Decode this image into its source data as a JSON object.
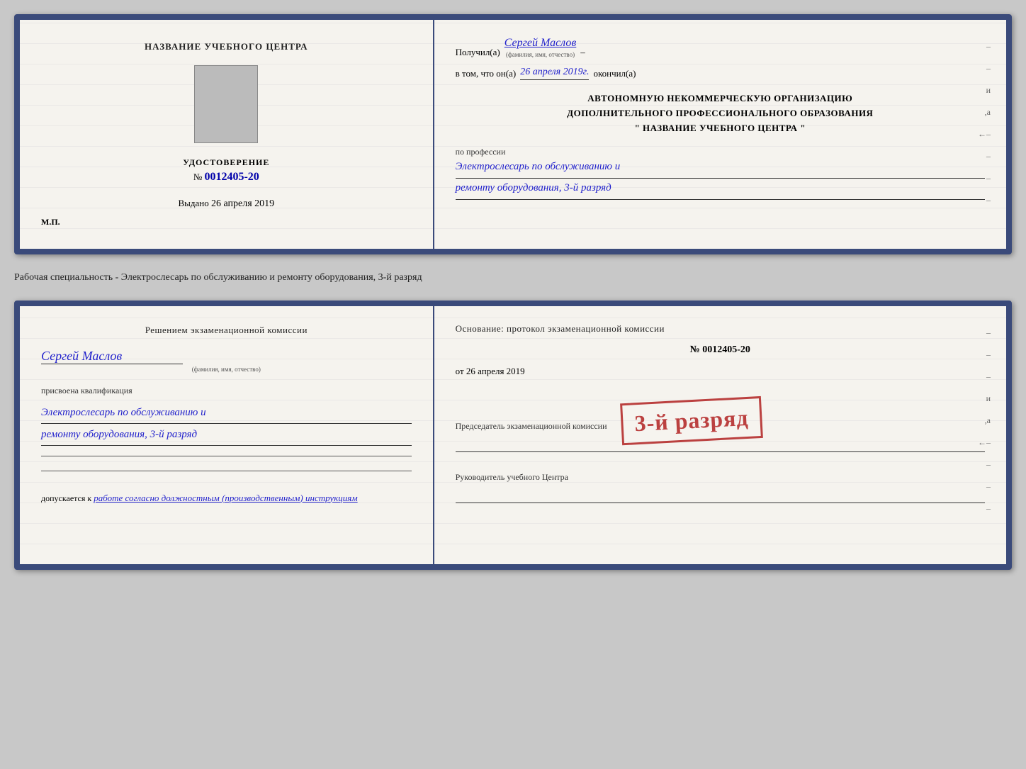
{
  "page": {
    "background": "#c8c8c8"
  },
  "card1": {
    "left": {
      "title": "НАЗВАНИЕ УЧЕБНОГО ЦЕНТРА",
      "document_type": "УДОСТОВЕРЕНИЕ",
      "number_prefix": "№",
      "number_value": "0012405-20",
      "issued_label": "Выдано",
      "issued_date": "26 апреля 2019",
      "mp_label": "М.П."
    },
    "right": {
      "received_label": "Получил(а)",
      "recipient_name": "Сергей Маслов",
      "recipient_sub": "(фамилия, имя, отчество)",
      "date_preamble": "в том, что он(а)",
      "date_value": "26 апреля 2019г.",
      "finished_label": "окончил(а)",
      "org_line1": "АВТОНОМНУЮ НЕКОММЕРЧЕСКУЮ ОРГАНИЗАЦИЮ",
      "org_line2": "ДОПОЛНИТЕЛЬНОГО ПРОФЕССИОНАЛЬНОГО ОБРАЗОВАНИЯ",
      "org_line3": "\"  НАЗВАНИЕ УЧЕБНОГО ЦЕНТРА  \"",
      "profession_label": "по профессии",
      "profession_line1": "Электрослесарь по обслуживанию и",
      "profession_line2": "ремонту оборудования, 3-й разряд"
    }
  },
  "between_text": "Рабочая специальность - Электрослесарь по обслуживанию и ремонту оборудования, 3-й разряд",
  "card2": {
    "left": {
      "commission_text": "Решением экзаменационной комиссии",
      "name": "Сергей Маслов",
      "name_sub": "(фамилия, имя, отчество)",
      "assigned_label": "присвоена квалификация",
      "qualification_line1": "Электрослесарь по обслуживанию и",
      "qualification_line2": "ремонту оборудования, 3-й разряд",
      "admitted_prefix": "допускается к",
      "admitted_text": "работе согласно должностным (производственным) инструкциям"
    },
    "right": {
      "basis_text": "Основание: протокол экзаменационной комиссии",
      "number_prefix": "№",
      "number_value": "0012405-20",
      "date_prefix": "от",
      "date_value": "26 апреля 2019",
      "chairman_label": "Председатель экзаменационной комиссии",
      "head_label": "Руководитель учебного Центра"
    },
    "stamp": {
      "text": "3-й разряд"
    }
  }
}
